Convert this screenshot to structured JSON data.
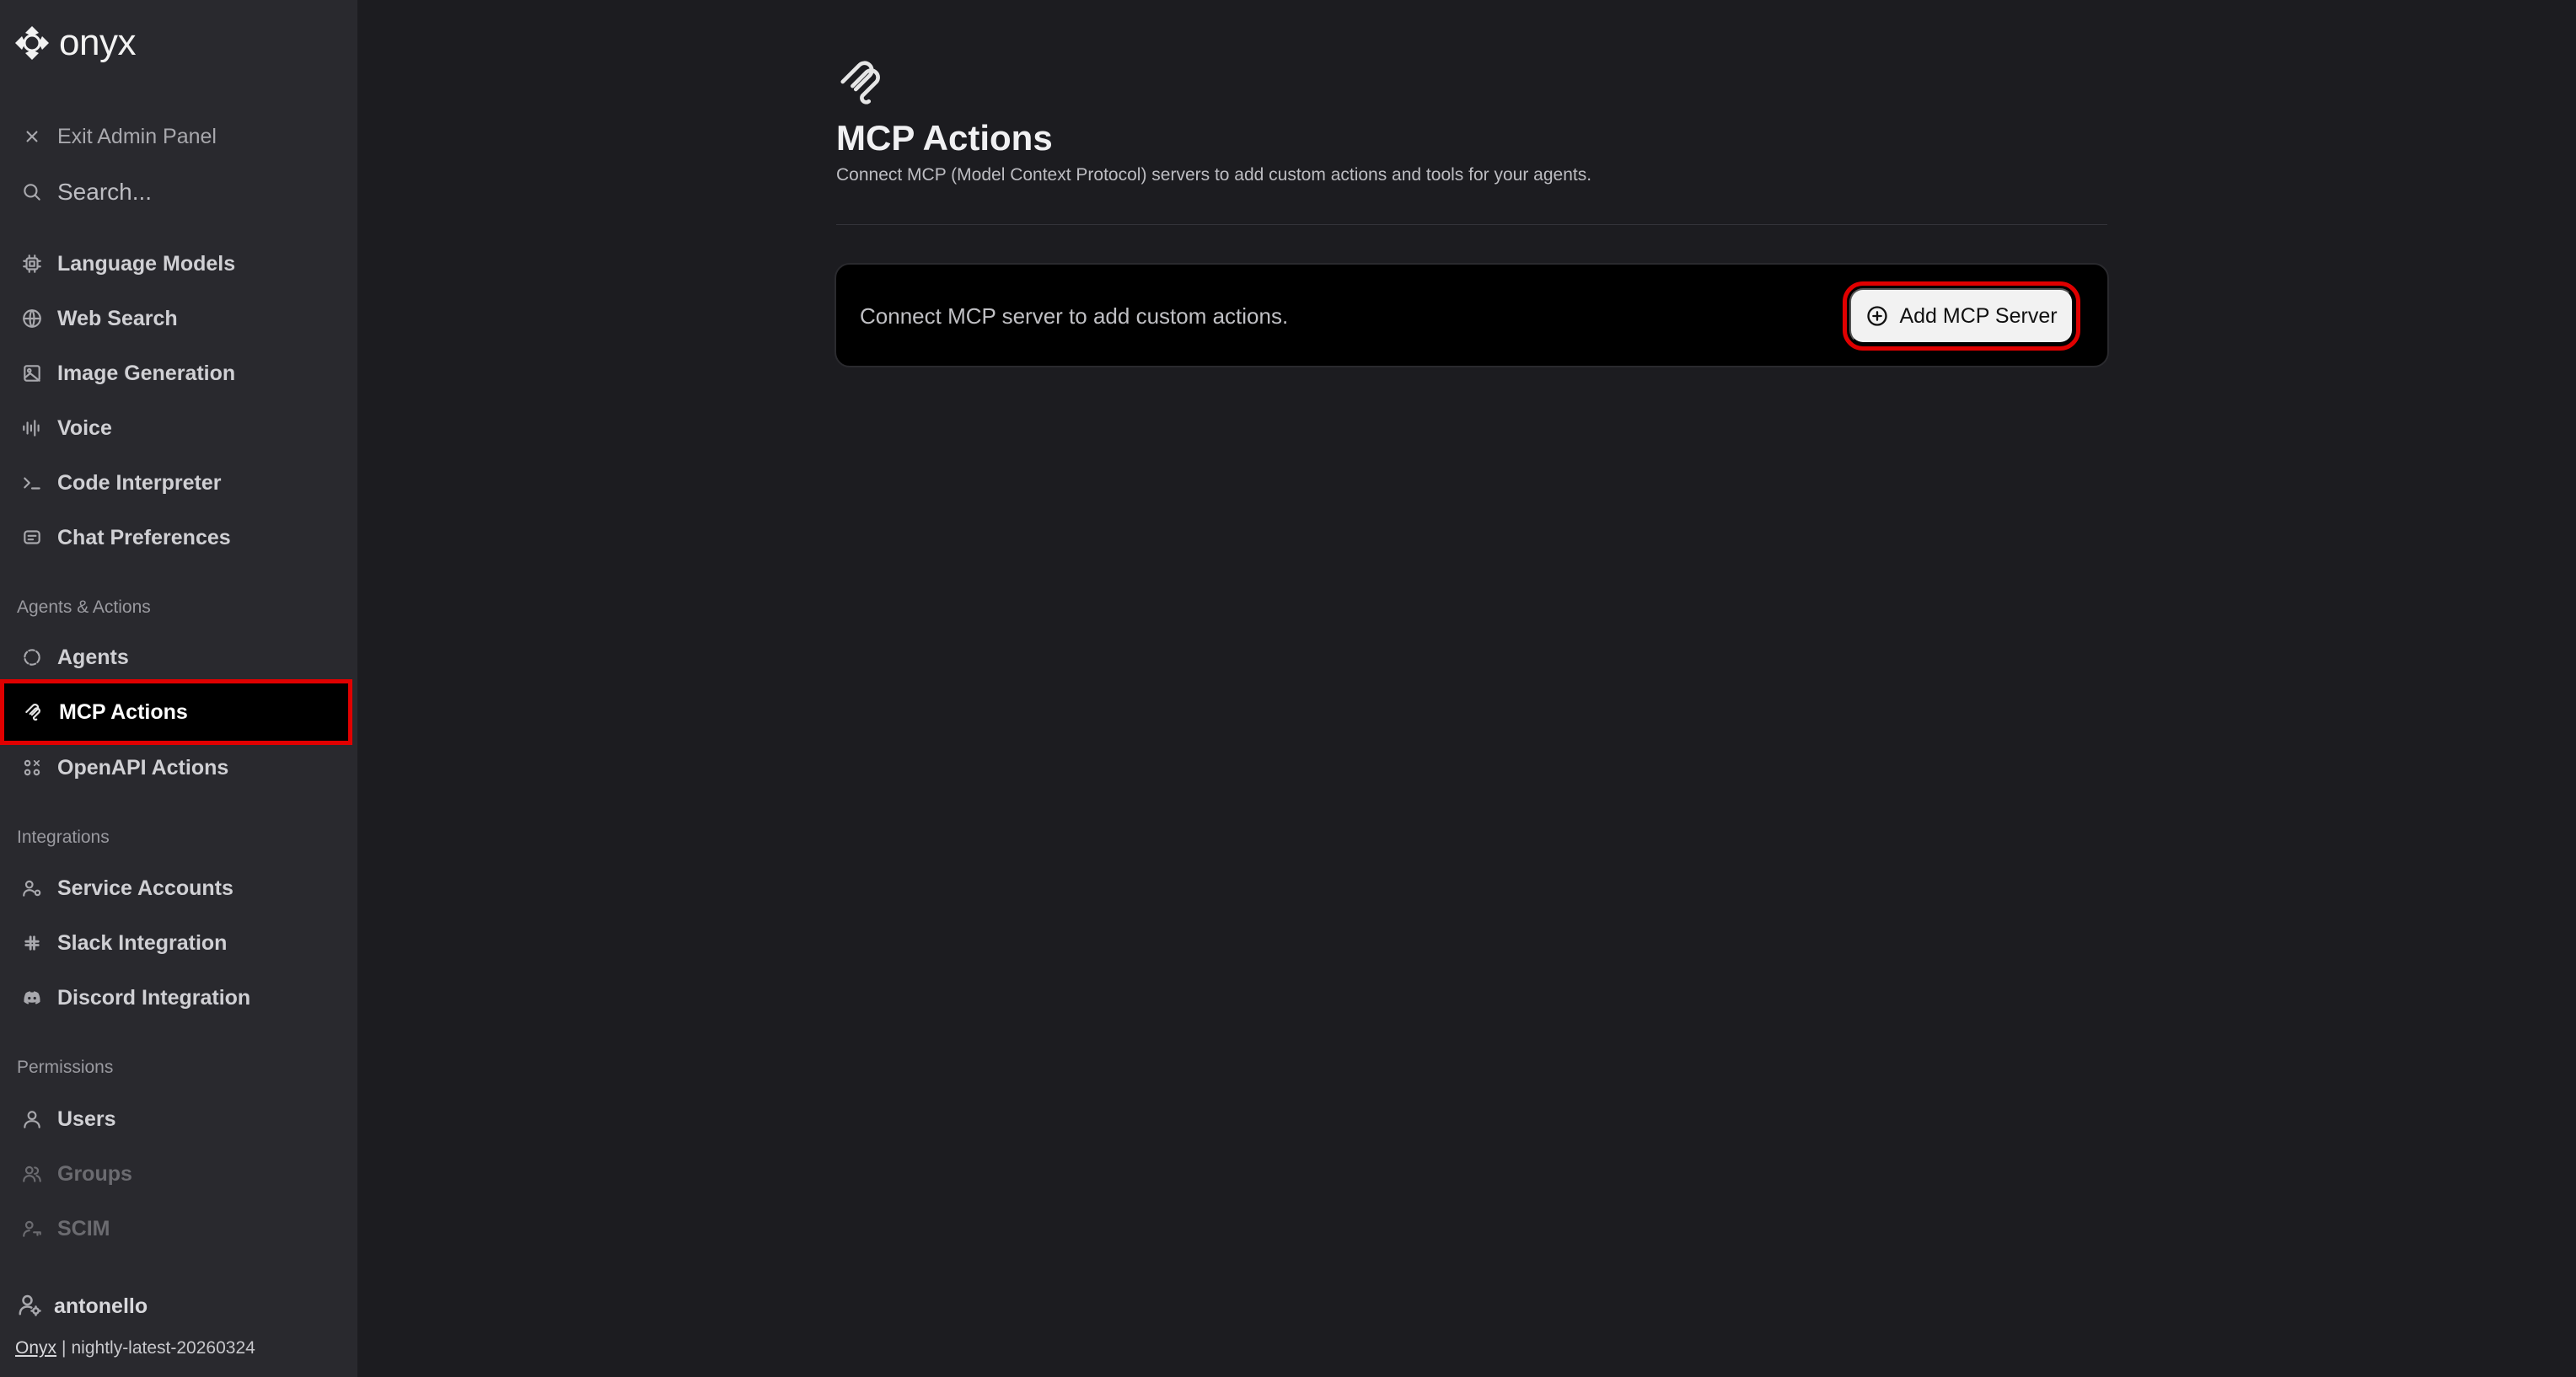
{
  "brand": {
    "name": "onyx"
  },
  "sidebar": {
    "exit_label": "Exit Admin Panel",
    "search_placeholder": "Search...",
    "items_top": [
      {
        "label": "Language Models",
        "icon": "cpu-icon"
      },
      {
        "label": "Web Search",
        "icon": "globe-icon"
      },
      {
        "label": "Image Generation",
        "icon": "image-icon"
      },
      {
        "label": "Voice",
        "icon": "audio-wave-icon"
      },
      {
        "label": "Code Interpreter",
        "icon": "terminal-icon"
      },
      {
        "label": "Chat Preferences",
        "icon": "chat-icon"
      }
    ],
    "section_agents": "Agents & Actions",
    "items_agents": [
      {
        "label": "Agents",
        "icon": "agent-circle-icon"
      },
      {
        "label": "MCP Actions",
        "icon": "mcp-icon",
        "active": true
      },
      {
        "label": "OpenAPI Actions",
        "icon": "openapi-icon"
      }
    ],
    "section_integrations": "Integrations",
    "items_integrations": [
      {
        "label": "Service Accounts",
        "icon": "user-gear-icon"
      },
      {
        "label": "Slack Integration",
        "icon": "slack-icon"
      },
      {
        "label": "Discord Integration",
        "icon": "discord-icon"
      }
    ],
    "section_permissions": "Permissions",
    "items_permissions": [
      {
        "label": "Users",
        "icon": "user-icon"
      },
      {
        "label": "Groups",
        "icon": "users-icon",
        "disabled": true
      },
      {
        "label": "SCIM",
        "icon": "user-key-icon",
        "disabled": true
      }
    ],
    "user_name": "antonello",
    "version_brand": "Onyx",
    "version_separator": "|",
    "version_string": "nightly-latest-20260324"
  },
  "main": {
    "title": "MCP Actions",
    "description": "Connect MCP (Model Context Protocol) servers to add custom actions and tools for your agents.",
    "card_text": "Connect MCP server to add custom actions.",
    "add_button_label": "Add MCP Server"
  },
  "colors": {
    "sidebar_bg": "#29292e",
    "main_bg": "#1c1c20",
    "highlight": "#e00000",
    "card_bg": "#000000",
    "button_bg": "#f2f2f2"
  }
}
